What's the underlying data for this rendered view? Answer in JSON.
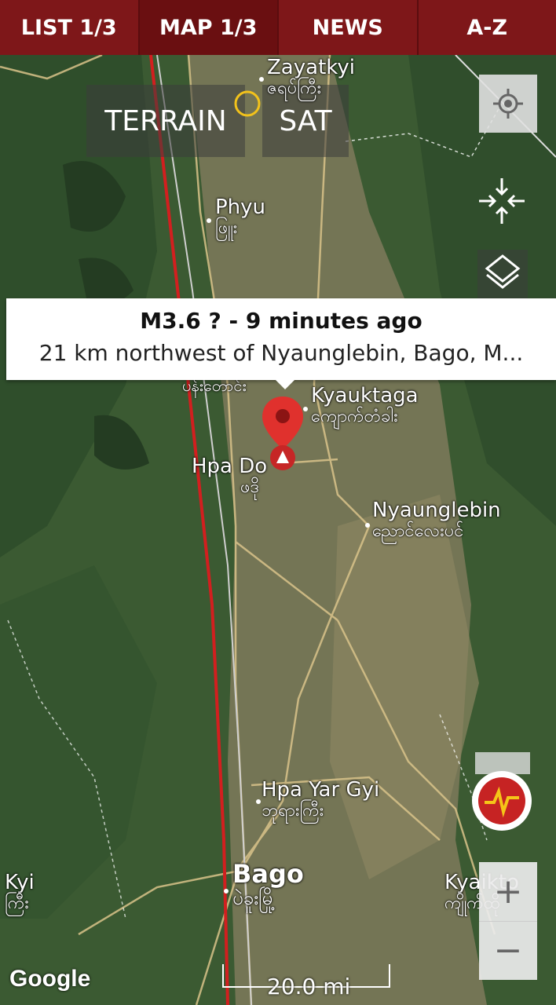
{
  "tabs": [
    {
      "label": "LIST 1/3"
    },
    {
      "label": "MAP 1/3"
    },
    {
      "label": "NEWS"
    },
    {
      "label": "A-Z"
    }
  ],
  "map_type": {
    "terrain": "TERRAIN",
    "sat": "SAT"
  },
  "event": {
    "headline": "M3.6 ?  -  9 minutes ago",
    "location": "21 km northwest of Nyaunglebin, Bago, M..."
  },
  "places": {
    "zayatkyi": {
      "en": "Zayatkyi",
      "my": "ဇရပ်ကြီး"
    },
    "phyu": {
      "en": "Phyu",
      "my": "ဖြူး"
    },
    "kyauktaga": {
      "en": "Kyauktaga",
      "my": "ကျောက်တံခါး"
    },
    "hpa_do": {
      "en": "Hpa Do",
      "my": "ဖဒို"
    },
    "nyaunglebin": {
      "en": "Nyaunglebin",
      "my": "ညောင်လေးပင်"
    },
    "hpa_yar_gyi": {
      "en": "Hpa Yar Gyi",
      "my": "ဘုရားကြီး"
    },
    "bago": {
      "en": "Bago",
      "my": "ပဲခူးမြို့"
    },
    "kyaikto": {
      "en": "Kyaikto",
      "my": "ကျိုက်ထို"
    },
    "kyi": {
      "en": "Kyi",
      "my": "ကြီး"
    },
    "cut_off": {
      "my": "ပန်းတောင်း"
    }
  },
  "attribution": "Google",
  "scale": "20.0 mi",
  "controls": {
    "zoom_in": "+",
    "zoom_out": "−"
  },
  "colors": {
    "tab_bg": "#7e1719",
    "fault_line": "#d21f1f",
    "pin": "#e0312d"
  }
}
